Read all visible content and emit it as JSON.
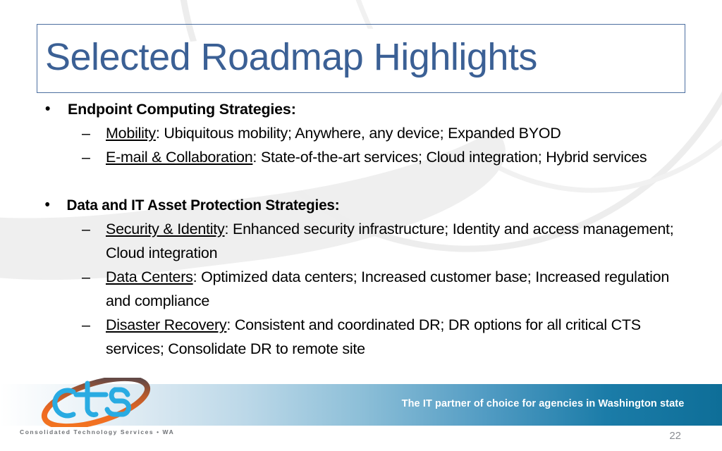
{
  "slide": {
    "title": "Selected Roadmap Highlights",
    "page_number": "22",
    "title_color": "#3b6095",
    "title_border_color": "#4c6fa0"
  },
  "content": {
    "sections": [
      {
        "heading": "Endpoint Computing Strategies:",
        "items": [
          {
            "term": "Mobility",
            "text": ": Ubiquitous mobility; Anywhere, any device; Expanded BYOD"
          },
          {
            "term": "E-mail & Collaboration",
            "text": ": State-of-the-art services; Cloud integration; Hybrid services"
          }
        ]
      },
      {
        "heading": "Data and IT Asset Protection Strategies:",
        "items": [
          {
            "term": "Security & Identity",
            "text": ": Enhanced security infrastructure; Identity and access management; Cloud integration"
          },
          {
            "term": "Data Centers",
            "text": ": Optimized data centers; Increased customer base; Increased regulation and compliance"
          },
          {
            "term": "Disaster Recovery",
            "text": ": Consistent and coordinated DR; DR options for all critical CTS services; Consolidate DR to remote site"
          }
        ]
      }
    ],
    "bullet_glyph": "•",
    "dash_glyph": "–"
  },
  "footer": {
    "tagline": "The IT partner of choice for agencies in Washington state",
    "logo_wordmark": "cts",
    "logo_caption": "Consolidated Technology Services • WA",
    "logo_cyan": "#29abe2",
    "logo_orange": "#f0712a",
    "band_end_color": "#0e6e98"
  }
}
